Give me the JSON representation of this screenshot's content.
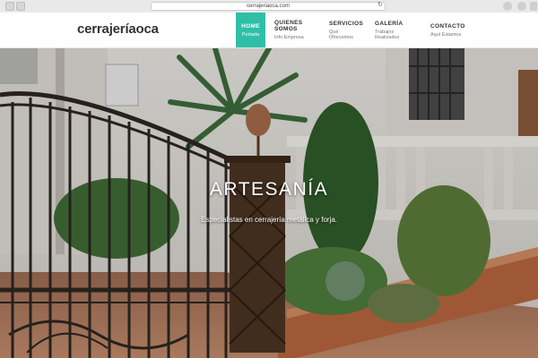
{
  "browser": {
    "url": "cerrajeriaoca.com"
  },
  "site": {
    "logo": "cerrajeríaoca"
  },
  "nav": [
    {
      "title": "HOME",
      "subtitle": "Portada"
    },
    {
      "title": "QUIENES SOMOS",
      "subtitle": "Info Empresa"
    },
    {
      "title": "SERVICIOS",
      "subtitle": "Qué Ofrecemos"
    },
    {
      "title": "GALERÍA",
      "subtitle": "Trabajos Realizados"
    },
    {
      "title": "CONTACTO",
      "subtitle": "Aquí Estamos"
    }
  ],
  "hero": {
    "title": "ARTESANÍA",
    "subtitle": "Especialistas en cerrajería metálica y forja."
  },
  "colors": {
    "accent": "#2fbfa8",
    "header_bg": "#ffffff"
  }
}
